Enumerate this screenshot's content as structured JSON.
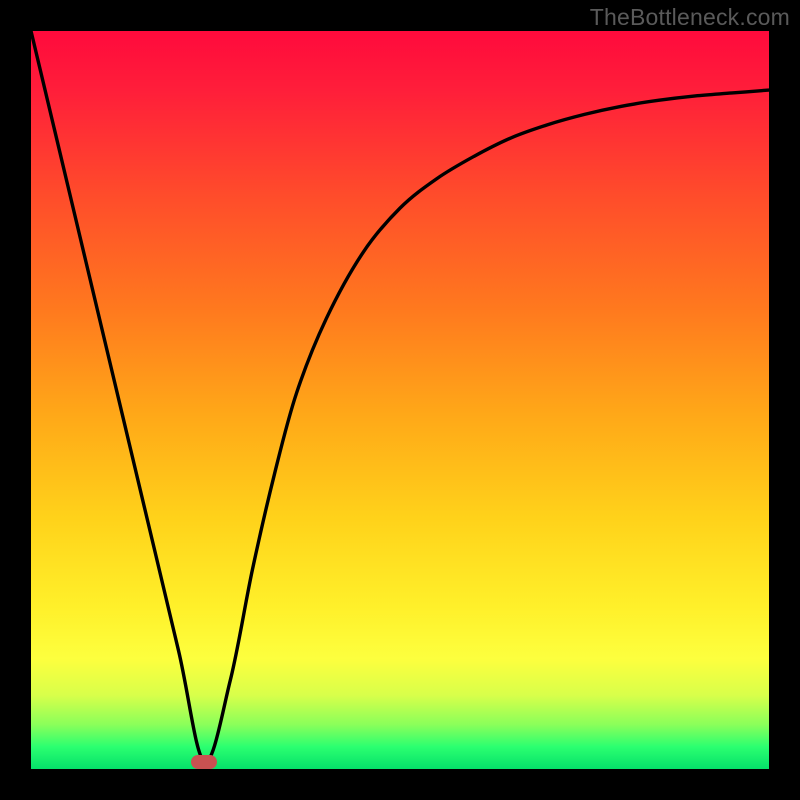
{
  "watermark": "TheBottleneck.com",
  "colors": {
    "frame": "#000000",
    "curve": "#000000",
    "marker": "#c95151"
  },
  "chart_data": {
    "type": "line",
    "title": "",
    "xlabel": "",
    "ylabel": "",
    "xlim": [
      0,
      100
    ],
    "ylim": [
      0,
      100
    ],
    "grid": false,
    "legend": false,
    "series": [
      {
        "name": "bottleneck-curve",
        "x": [
          0,
          5,
          10,
          15,
          20,
          23.5,
          27,
          30,
          33,
          36,
          40,
          45,
          50,
          55,
          60,
          65,
          70,
          75,
          80,
          85,
          90,
          95,
          100
        ],
        "y": [
          100,
          79,
          58,
          37,
          16,
          1,
          12,
          27,
          40,
          51,
          61,
          70,
          76,
          80,
          83,
          85.5,
          87.3,
          88.7,
          89.8,
          90.6,
          91.2,
          91.6,
          92
        ]
      }
    ],
    "marker": {
      "x": 23.5,
      "y": 1
    },
    "notes": "Values are approximate, read from the rendered curve relative to the plot area. y=0 is plot bottom, y=100 is plot top."
  }
}
